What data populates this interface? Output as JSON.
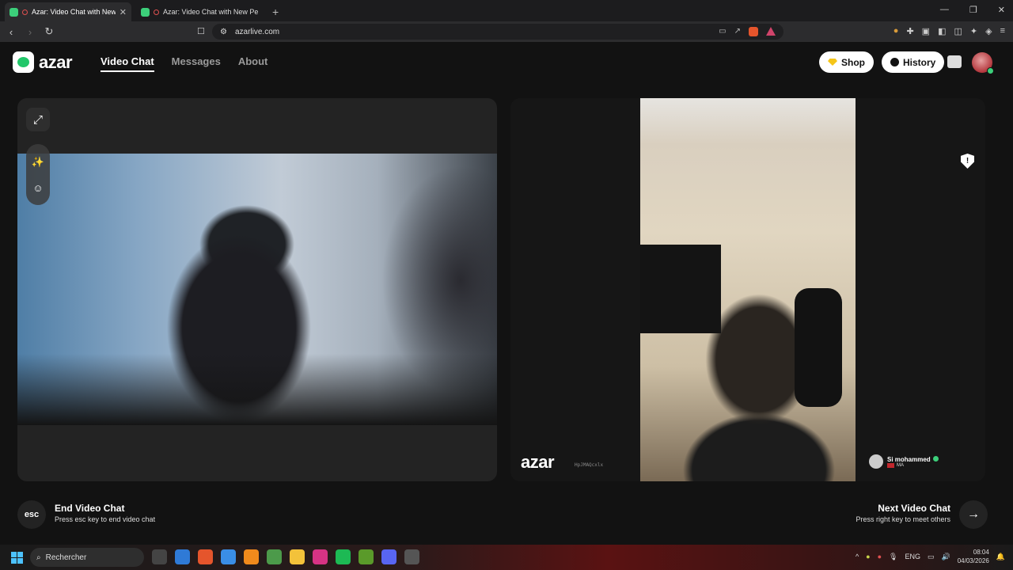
{
  "browser": {
    "tabs": [
      {
        "title": "Azar: Video Chat with New People",
        "active": true
      },
      {
        "title": "Azar: Video Chat with New People",
        "active": false
      }
    ],
    "new_tab": "+",
    "url": "azarlive.com"
  },
  "app": {
    "logo": "azar",
    "nav": [
      "Video Chat",
      "Messages",
      "About"
    ],
    "shop_label": "Shop",
    "history_label": "History"
  },
  "partner": {
    "watermark": "azar",
    "watermark_id": "HpJMAQcxlx",
    "name": "Si mohammed",
    "country": "MA"
  },
  "controls": {
    "esc_key": "esc",
    "end_title": "End Video Chat",
    "end_sub": "Press esc key to end video chat",
    "next_title": "Next Video Chat",
    "next_sub": "Press right key to meet others",
    "next_arrow": "→"
  },
  "taskbar": {
    "search_placeholder": "Rechercher",
    "lang": "ENG",
    "time": "08:04",
    "date": "04/03/2026"
  },
  "colors": {
    "accent": "#22c76a",
    "bg": "#121212",
    "panel": "#232323"
  }
}
